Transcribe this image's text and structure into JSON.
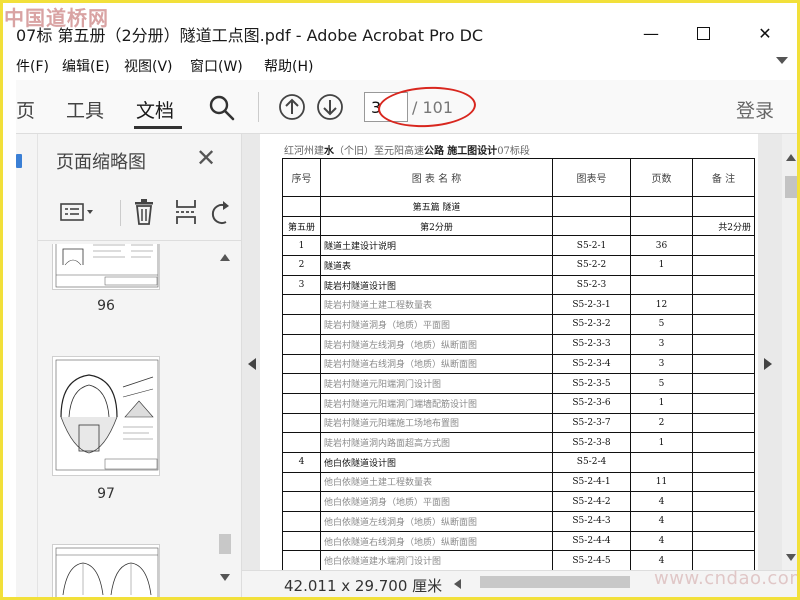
{
  "watermark_top": "中国道桥网",
  "watermark_bottom": "www.cndao.com",
  "window": {
    "title": "07标 第五册（2分册）隧道工点图.pdf - Adobe Acrobat Pro DC",
    "minimize_glyph": "—",
    "close_glyph": "✕"
  },
  "menu": {
    "items": [
      "件(F)",
      "编辑(E)",
      "视图(V)",
      "窗口(W)",
      "帮助(H)"
    ]
  },
  "toolbar": {
    "tabs": [
      "页",
      "工具",
      "文档"
    ],
    "active_tab": "文档",
    "current_page": "3",
    "total_pages": "/ 101",
    "login": "登录"
  },
  "left_panel": {
    "title": "页面缩略图",
    "close_glyph": "✕",
    "thumbnails": [
      {
        "label": "96"
      },
      {
        "label": "97"
      },
      {
        "label": ""
      }
    ]
  },
  "document": {
    "header_prefix": "红河州建",
    "header_bold1": "水",
    "header_mid": "（个旧）至元阳高速",
    "header_bold2": "公路",
    "header_sep": "  ",
    "header_bold3": "施工图设计",
    "header_suffix": "07标段",
    "columns": [
      "序号",
      "图  表  名  称",
      "图表号",
      "页数",
      "备    注"
    ],
    "rows": [
      {
        "no": "",
        "name": "第五篇  隧道",
        "code": "",
        "pages": "",
        "note": "",
        "style": "center"
      },
      {
        "no": "第五册",
        "name": "第2分册",
        "code": "",
        "pages": "",
        "note": "共2分册",
        "style": "center"
      },
      {
        "no": "1",
        "name": "隧道土建设计说明",
        "code": "S5-2-1",
        "pages": "36",
        "note": "",
        "style": "normal"
      },
      {
        "no": "2",
        "name": "隧道表",
        "code": "S5-2-2",
        "pages": "1",
        "note": "",
        "style": "normal"
      },
      {
        "no": "3",
        "name": "陡岩村隧道设计图",
        "code": "S5-2-3",
        "pages": "",
        "note": "",
        "style": "normal"
      },
      {
        "no": "",
        "name": "陡岩村隧道土建工程数量表",
        "code": "S5-2-3-1",
        "pages": "12",
        "note": "",
        "style": "grey"
      },
      {
        "no": "",
        "name": "陡岩村隧道洞身（地质）平面图",
        "code": "S5-2-3-2",
        "pages": "5",
        "note": "",
        "style": "grey"
      },
      {
        "no": "",
        "name": "陡岩村隧道左线洞身（地质）纵断面图",
        "code": "S5-2-3-3",
        "pages": "3",
        "note": "",
        "style": "grey"
      },
      {
        "no": "",
        "name": "陡岩村隧道右线洞身（地质）纵断面图",
        "code": "S5-2-3-4",
        "pages": "3",
        "note": "",
        "style": "grey"
      },
      {
        "no": "",
        "name": "陡岩村隧道元阳端洞门设计图",
        "code": "S5-2-3-5",
        "pages": "5",
        "note": "",
        "style": "grey"
      },
      {
        "no": "",
        "name": "陡岩村隧道元阳端洞门端墙配筋设计图",
        "code": "S5-2-3-6",
        "pages": "1",
        "note": "",
        "style": "grey"
      },
      {
        "no": "",
        "name": "陡岩村隧道元阳端施工场地布置图",
        "code": "S5-2-3-7",
        "pages": "2",
        "note": "",
        "style": "grey"
      },
      {
        "no": "",
        "name": "陡岩村隧道洞内路面超高方式图",
        "code": "S5-2-3-8",
        "pages": "1",
        "note": "",
        "style": "grey"
      },
      {
        "no": "4",
        "name": "他白依隧道设计图",
        "code": "S5-2-4",
        "pages": "",
        "note": "",
        "style": "normal"
      },
      {
        "no": "",
        "name": "他白依隧道土建工程数量表",
        "code": "S5-2-4-1",
        "pages": "11",
        "note": "",
        "style": "grey"
      },
      {
        "no": "",
        "name": "他白依隧道洞身（地质）平面图",
        "code": "S5-2-4-2",
        "pages": "4",
        "note": "",
        "style": "grey"
      },
      {
        "no": "",
        "name": "他白依隧道左线洞身（地质）纵断面图",
        "code": "S5-2-4-3",
        "pages": "4",
        "note": "",
        "style": "grey"
      },
      {
        "no": "",
        "name": "他白依隧道右线洞身（地质）纵断面图",
        "code": "S5-2-4-4",
        "pages": "4",
        "note": "",
        "style": "grey"
      },
      {
        "no": "",
        "name": "他白依隧道建水端洞门设计图",
        "code": "S5-2-4-5",
        "pages": "4",
        "note": "",
        "style": "grey"
      }
    ]
  },
  "status": {
    "page_size": "42.011 x 29.700 厘米"
  },
  "colors": {
    "annotation_circle": "#d8261e",
    "frame_border": "#f2e03a",
    "accent_blue": "#3a7fd5"
  }
}
